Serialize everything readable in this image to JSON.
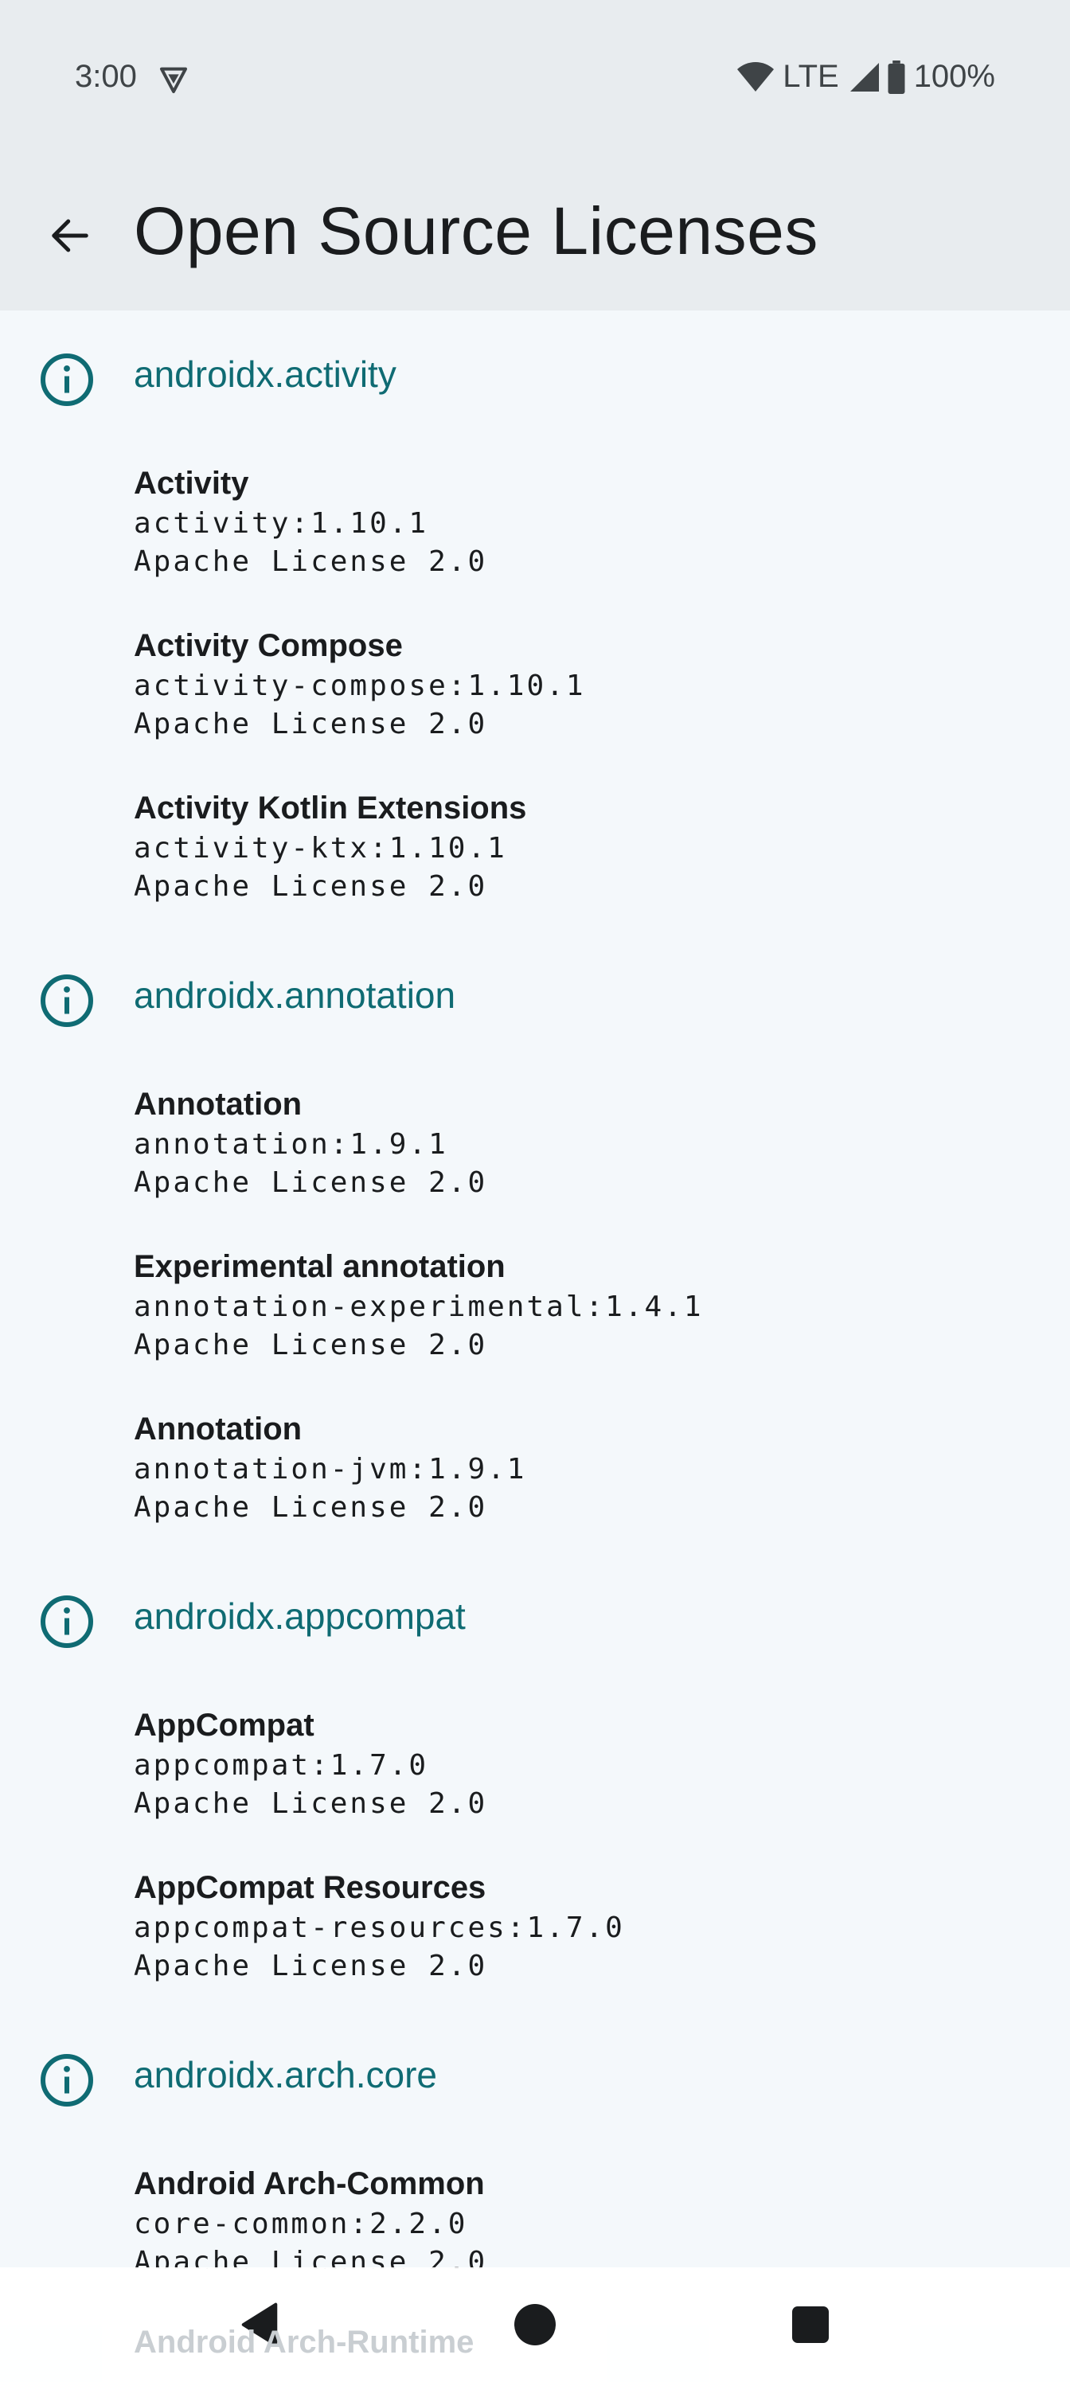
{
  "status": {
    "time": "3:00",
    "network": "LTE",
    "battery": "100%"
  },
  "appbar": {
    "title": "Open Source Licenses"
  },
  "groups": [
    {
      "title": "androidx.activity",
      "libs": [
        {
          "name": "Activity",
          "artifact": "activity:1.10.1",
          "license": "Apache License 2.0"
        },
        {
          "name": "Activity Compose",
          "artifact": "activity-compose:1.10.1",
          "license": "Apache License 2.0"
        },
        {
          "name": "Activity Kotlin Extensions",
          "artifact": "activity-ktx:1.10.1",
          "license": "Apache License 2.0"
        }
      ]
    },
    {
      "title": "androidx.annotation",
      "libs": [
        {
          "name": "Annotation",
          "artifact": "annotation:1.9.1",
          "license": "Apache License 2.0"
        },
        {
          "name": "Experimental annotation",
          "artifact": "annotation-experimental:1.4.1",
          "license": "Apache License 2.0"
        },
        {
          "name": "Annotation",
          "artifact": "annotation-jvm:1.9.1",
          "license": "Apache License 2.0"
        }
      ]
    },
    {
      "title": "androidx.appcompat",
      "libs": [
        {
          "name": "AppCompat",
          "artifact": "appcompat:1.7.0",
          "license": "Apache License 2.0"
        },
        {
          "name": "AppCompat Resources",
          "artifact": "appcompat-resources:1.7.0",
          "license": "Apache License 2.0"
        }
      ]
    },
    {
      "title": "androidx.arch.core",
      "libs": [
        {
          "name": "Android Arch-Common",
          "artifact": "core-common:2.2.0",
          "license": "Apache License 2.0"
        },
        {
          "name": "Android Arch-Runtime",
          "artifact": "",
          "license": ""
        }
      ]
    }
  ],
  "icons": {
    "back": "arrow-back-icon",
    "info": "info-icon",
    "nav_back": "nav-back-icon",
    "nav_home": "nav-home-icon",
    "nav_recents": "nav-recents-icon"
  },
  "colors": {
    "accent": "#0f6b73",
    "background": "#f4f8fb",
    "appbar": "#e8ecef"
  }
}
